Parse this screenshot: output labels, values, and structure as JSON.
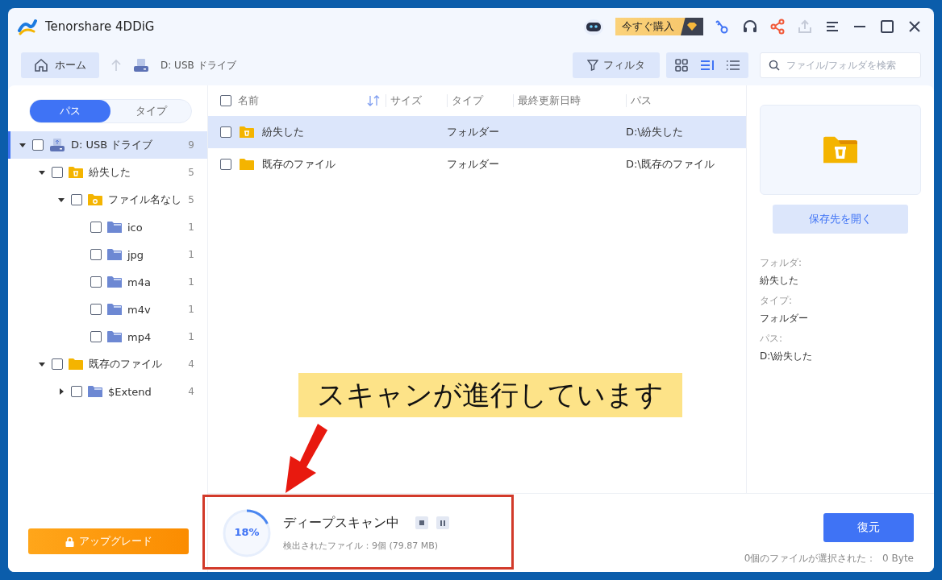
{
  "window": {
    "title": "Tenorshare 4DDiG",
    "buy_button": "今すぐ購入"
  },
  "toolbar": {
    "home_button": "ホーム",
    "location": "D: USB ドライブ",
    "filter_button": "フィルタ",
    "search": {
      "placeholder": "ファイル/フォルダを検索"
    },
    "views": [
      {
        "kind": "grid",
        "selected": false
      },
      {
        "kind": "detail",
        "selected": true
      },
      {
        "kind": "list",
        "selected": false
      }
    ]
  },
  "sidebar": {
    "tabs": [
      {
        "label": "パス",
        "selected": true
      },
      {
        "label": "タイプ",
        "selected": false
      }
    ],
    "tree": [
      {
        "name": "D: USB ドライブ",
        "kind": "drive",
        "count": "9",
        "expanded": true,
        "checked": false,
        "selected": true,
        "children": [
          {
            "name": "紛失した",
            "kind": "lost",
            "count": "5",
            "expanded": true,
            "checked": false,
            "selected": false,
            "children": [
              {
                "name": "ファイル名なし",
                "kind": "unnamed",
                "count": "5",
                "expanded": true,
                "checked": false,
                "selected": false,
                "children": [
                  {
                    "name": "ico",
                    "kind": "folder-blue",
                    "count": "1",
                    "checked": false,
                    "selected": false
                  },
                  {
                    "name": "jpg",
                    "kind": "folder-blue",
                    "count": "1",
                    "checked": false,
                    "selected": false
                  },
                  {
                    "name": "m4a",
                    "kind": "folder-blue",
                    "count": "1",
                    "checked": false,
                    "selected": false
                  },
                  {
                    "name": "m4v",
                    "kind": "folder-blue",
                    "count": "1",
                    "checked": false,
                    "selected": false
                  },
                  {
                    "name": "mp4",
                    "kind": "folder-blue",
                    "count": "1",
                    "checked": false,
                    "selected": false
                  }
                ]
              }
            ]
          },
          {
            "name": "既存のファイル",
            "kind": "folder-yellow",
            "count": "4",
            "expanded": true,
            "checked": false,
            "selected": false,
            "children": [
              {
                "name": "$Extend",
                "kind": "folder-blue",
                "count": "4",
                "expanded": false,
                "checked": false,
                "selected": false
              }
            ]
          }
        ]
      }
    ],
    "upgrade_button": "アップグレード"
  },
  "table": {
    "select_all_checked": false,
    "columns": [
      "名前",
      "サイズ",
      "タイプ",
      "最終更新日時",
      "パス"
    ],
    "rows": [
      {
        "name": "紛失した",
        "kind": "lost",
        "type": "フォルダー",
        "path": "D:\\紛失した",
        "checked": false,
        "selected": true
      },
      {
        "name": "既存のファイル",
        "kind": "folder-yellow",
        "type": "フォルダー",
        "path": "D:\\既存のファイル",
        "checked": false,
        "selected": false
      }
    ]
  },
  "detail": {
    "open_button": "保存先を開く",
    "fields": [
      {
        "label": "フォルダ:",
        "value": "紛失した"
      },
      {
        "label": "タイプ:",
        "value": "フォルダー"
      },
      {
        "label": "パス:",
        "value": "D:\\紛失した"
      }
    ]
  },
  "scan": {
    "percent": "18%",
    "level": 0.18,
    "title": "ディープスキャン中",
    "found": "検出されたファイル：9個 (79.87 MB)"
  },
  "footer": {
    "recover_button": "復元",
    "selection": "0個のファイルが選択された：  0 Byte"
  },
  "annotation": {
    "callout": "スキャンが進行しています"
  }
}
